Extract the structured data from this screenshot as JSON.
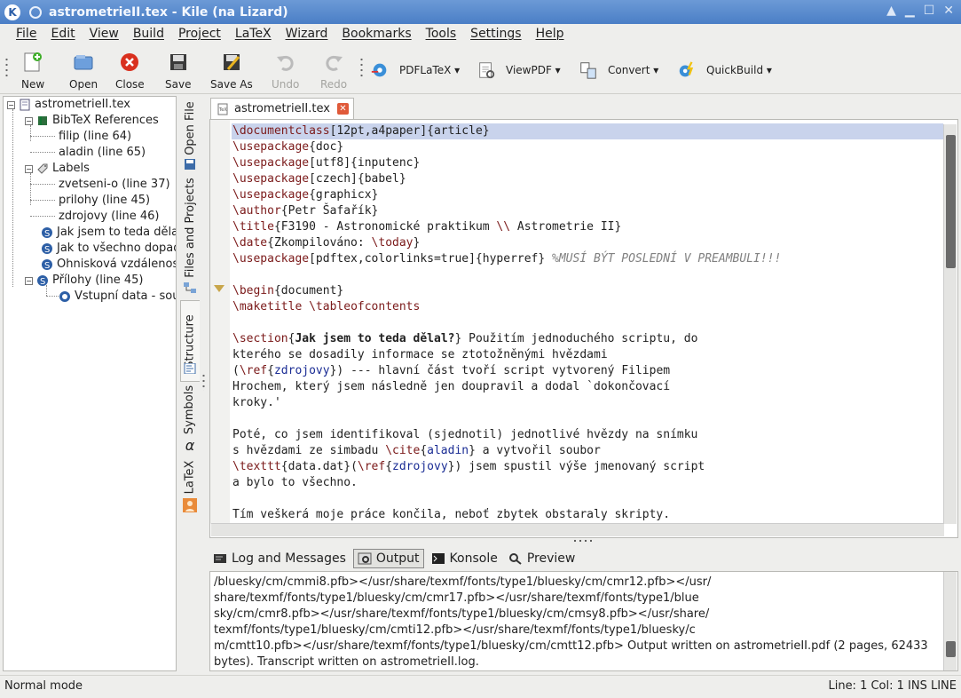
{
  "window": {
    "title": "astrometrieII.tex - Kile (na Lizard)"
  },
  "menu": [
    "File",
    "Edit",
    "View",
    "Build",
    "Project",
    "LaTeX",
    "Wizard",
    "Bookmarks",
    "Tools",
    "Settings",
    "Help"
  ],
  "toolbar": {
    "new": "New",
    "open": "Open",
    "close": "Close",
    "save": "Save",
    "save_as": "Save As",
    "undo": "Undo",
    "redo": "Redo",
    "pdflatex": "PDFLaTeX",
    "viewpdf": "ViewPDF",
    "convert": "Convert",
    "quickbuild": "QuickBuild"
  },
  "tree": {
    "root": "astrometrieII.tex",
    "bibtex": "BibTeX References",
    "bib_items": [
      "filip (line 64)",
      "aladin (line 65)"
    ],
    "labels": "Labels",
    "label_items": [
      "zvetseni-o (line 37)",
      "prilohy (line 45)",
      "zdrojovy (line 46)"
    ],
    "sections": [
      "Jak jsem to teda dělal",
      "Jak to všechno dopad",
      "Ohnisková vzdálenost"
    ],
    "prilohy": "Přílohy (line 45)",
    "prilohy_child": "Vstupní data - sou"
  },
  "sidetabs": {
    "open_file": "Open File",
    "files_projects": "Files and Projects",
    "structure": "Structure",
    "symbols": "Symbols",
    "latex": "LaTeX"
  },
  "editor": {
    "tab_label": "astrometrieII.tex",
    "lines": [
      "\\documentclass[12pt,a4paper]{article}",
      "\\usepackage{doc}",
      "\\usepackage[utf8]{inputenc}",
      "\\usepackage[czech]{babel}",
      "\\usepackage{graphicx}",
      "\\author{Petr Šafařík}",
      "\\title{F3190 - Astronomické praktikum \\\\ Astrometrie II}",
      "\\date{Zkompilováno: \\today}",
      "\\usepackage[pdftex,colorlinks=true]{hyperref} %MUSÍ BÝT POSLEDNÍ V PREAMBULI!!!",
      "",
      "\\begin{document}",
      "\\maketitle \\tableofcontents",
      "",
      "\\section{Jak jsem to teda dělal?} Použitím jednoduchého scriptu, do",
      "kterého se dosadily informace se ztotožněnými hvězdami",
      "(\\ref{zdrojovy}) --- hlavní část tvoří script vytvorený Filipem",
      "Hrochem, který jsem následně jen doupravil a dodal `dokončovací",
      "kroky.'",
      "",
      "Poté, co jsem identifikoval (sjednotil) jednotlivé hvězdy na snímku",
      "s hvězdami ze simbadu \\cite{aladin} a vytvořil soubor",
      "\\texttt{data.dat}(\\ref{zdrojovy}) jsem spustil výše jmenovaný script",
      "a bylo to všechno.",
      "",
      "Tím veškerá moje práce končila, neboť zbytek obstaraly skripty."
    ]
  },
  "bottom_tabs": [
    "Log and Messages",
    "Output",
    "Konsole",
    "Preview"
  ],
  "output_text": "/bluesky/cm/cmmi8.pfb></usr/share/texmf/fonts/type1/bluesky/cm/cmr12.pfb></usr/\nshare/texmf/fonts/type1/bluesky/cm/cmr17.pfb></usr/share/texmf/fonts/type1/blue\nsky/cm/cmr8.pfb></usr/share/texmf/fonts/type1/bluesky/cm/cmsy8.pfb></usr/share/\ntexmf/fonts/type1/bluesky/cm/cmti12.pfb></usr/share/texmf/fonts/type1/bluesky/c\nm/cmtt10.pfb></usr/share/texmf/fonts/type1/bluesky/cm/cmtt12.pfb> Output written on astrometrieII.pdf (2 pages, 62433\nbytes). Transcript written on astrometrieII.log.",
  "status": {
    "mode": "Normal mode",
    "position": "Line: 1 Col: 1  INS  LINE"
  }
}
